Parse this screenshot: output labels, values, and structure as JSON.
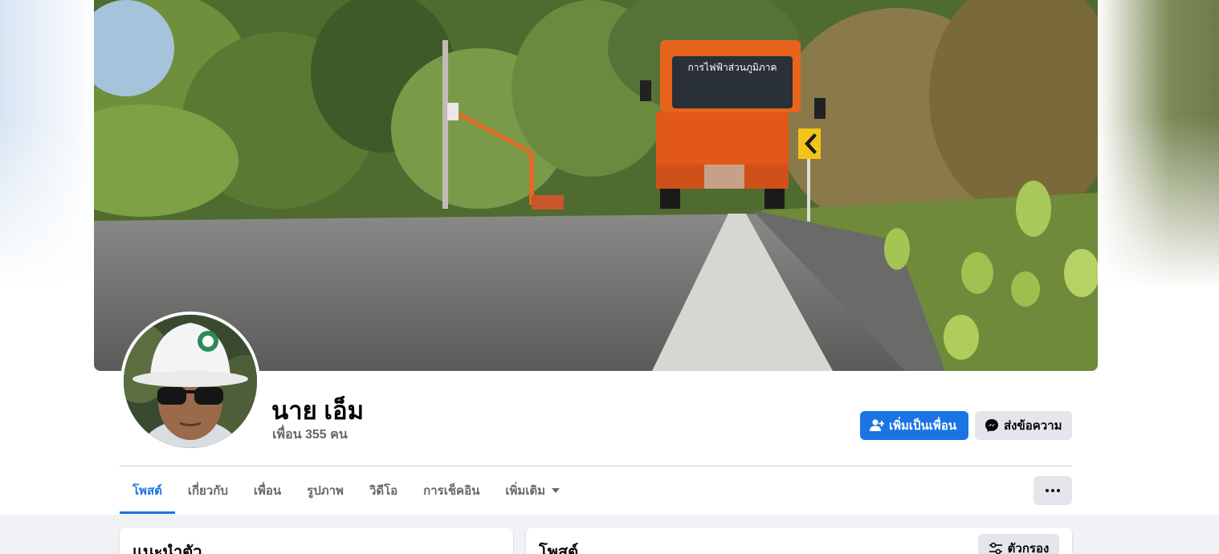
{
  "profile": {
    "name": "นาย เอ็ม",
    "friends_label": "เพื่อน 355 คน"
  },
  "cover": {
    "truck_text": "การไฟฟ้าส่วนภูมิภาค"
  },
  "actions": {
    "add_friend_label": "เพิ่มเป็นเพื่อน",
    "message_label": "ส่งข้อความ"
  },
  "tabs": [
    {
      "label": "โพสต์",
      "active": true
    },
    {
      "label": "เกี่ยวกับ"
    },
    {
      "label": "เพื่อน"
    },
    {
      "label": "รูปภาพ"
    },
    {
      "label": "วิดีโอ"
    },
    {
      "label": "การเช็คอิน"
    },
    {
      "label": "เพิ่มเติม"
    }
  ],
  "intro": {
    "title": "แนะนำตัว"
  },
  "posts": {
    "title": "โพสต์",
    "filter_label": "ตัวกรอง"
  },
  "colors": {
    "accent": "#1b74e4",
    "secondary_button": "#e4e6eb",
    "muted_text": "#65676b"
  }
}
